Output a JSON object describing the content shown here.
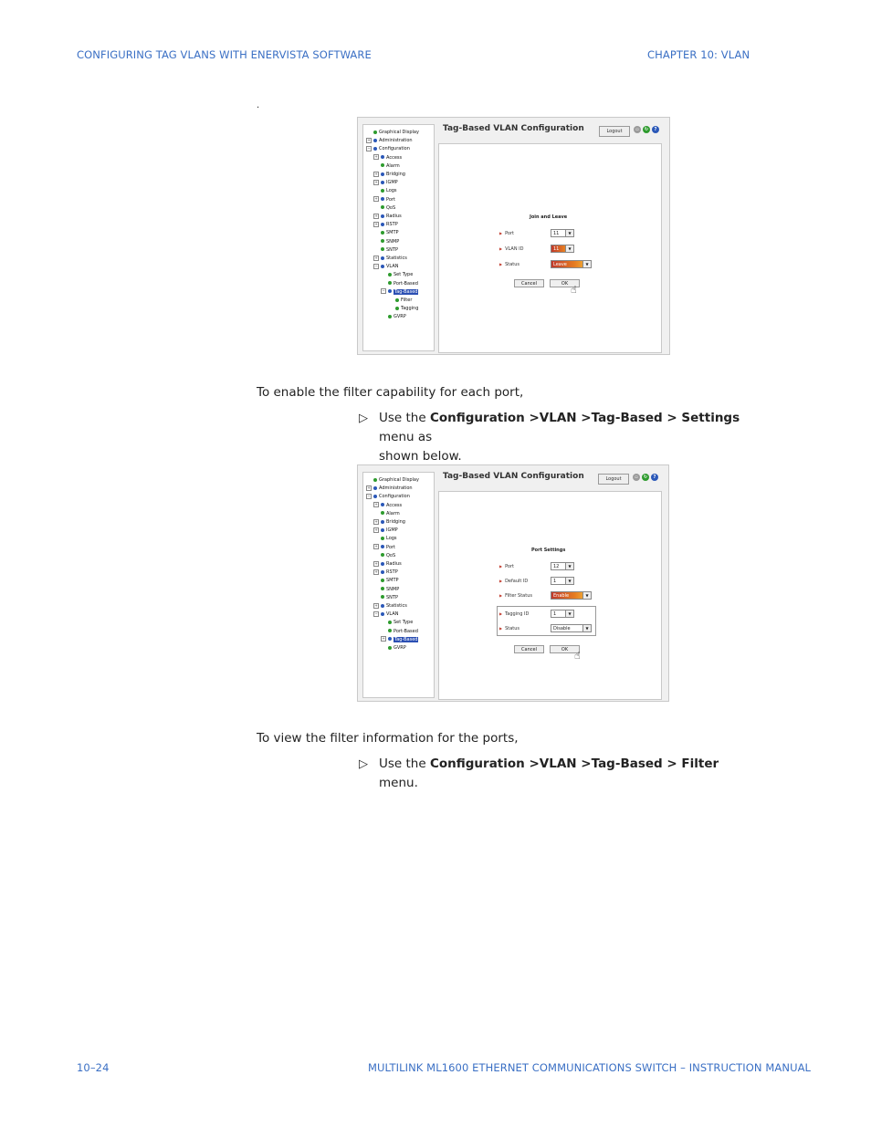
{
  "header": {
    "left": "CONFIGURING TAG VLANS WITH ENERVISTA SOFTWARE",
    "right": "CHAPTER 10: VLAN"
  },
  "stray_mark": ".",
  "shot1": {
    "title": "Tag-Based VLAN Configuration",
    "logout": "Logout",
    "tree": [
      {
        "label": "Graphical Display",
        "pm": "",
        "dot": "green"
      },
      {
        "label": "Administration",
        "pm": "+",
        "dot": "blue"
      },
      {
        "label": "Configuration",
        "pm": "−",
        "dot": "blue"
      },
      {
        "label": "Access",
        "pm": "+",
        "dot": "blue"
      },
      {
        "label": "Alarm",
        "pm": "",
        "dot": "green"
      },
      {
        "label": "Bridging",
        "pm": "+",
        "dot": "blue"
      },
      {
        "label": "IGMP",
        "pm": "+",
        "dot": "blue"
      },
      {
        "label": "Logs",
        "pm": "",
        "dot": "green"
      },
      {
        "label": "Port",
        "pm": "+",
        "dot": "blue"
      },
      {
        "label": "QoS",
        "pm": "",
        "dot": "green"
      },
      {
        "label": "Radius",
        "pm": "+",
        "dot": "blue"
      },
      {
        "label": "RSTP",
        "pm": "+",
        "dot": "blue"
      },
      {
        "label": "SMTP",
        "pm": "",
        "dot": "green"
      },
      {
        "label": "SNMP",
        "pm": "",
        "dot": "green"
      },
      {
        "label": "SNTP",
        "pm": "",
        "dot": "green"
      },
      {
        "label": "Statistics",
        "pm": "+",
        "dot": "blue"
      },
      {
        "label": "VLAN",
        "pm": "−",
        "dot": "blue"
      },
      {
        "label": "Set Type",
        "pm": "",
        "dot": "green"
      },
      {
        "label": "Port-Based",
        "pm": "",
        "dot": "green"
      },
      {
        "label": "Tag-Based",
        "pm": "−",
        "dot": "blue",
        "selected": true
      },
      {
        "label": "Filter",
        "pm": "",
        "dot": "green"
      },
      {
        "label": "Tagging",
        "pm": "",
        "dot": "green"
      },
      {
        "label": "GVRP",
        "pm": "",
        "dot": "green"
      }
    ],
    "form_title": "Join and Leave",
    "fields": [
      {
        "label": "Port",
        "value": "11",
        "hot": false
      },
      {
        "label": "VLAN ID",
        "value": "11",
        "hot": true
      },
      {
        "label": "Status",
        "value": "Leave",
        "hot": true
      }
    ],
    "cancel": "Cancel",
    "ok": "OK"
  },
  "instruction1": {
    "lead": "To enable the filter capability for each port,",
    "use": "Use the ",
    "bold": "Configuration >VLAN >Tag-Based > Settings",
    "rest": " menu as",
    "line2": "shown below."
  },
  "shot2": {
    "title": "Tag-Based VLAN Configuration",
    "logout": "Logout",
    "tree": [
      {
        "label": "Graphical Display",
        "pm": "",
        "dot": "green"
      },
      {
        "label": "Administration",
        "pm": "+",
        "dot": "blue"
      },
      {
        "label": "Configuration",
        "pm": "−",
        "dot": "blue"
      },
      {
        "label": "Access",
        "pm": "+",
        "dot": "blue"
      },
      {
        "label": "Alarm",
        "pm": "",
        "dot": "green"
      },
      {
        "label": "Bridging",
        "pm": "+",
        "dot": "blue"
      },
      {
        "label": "IGMP",
        "pm": "+",
        "dot": "blue"
      },
      {
        "label": "Logs",
        "pm": "",
        "dot": "green"
      },
      {
        "label": "Port",
        "pm": "+",
        "dot": "blue"
      },
      {
        "label": "QoS",
        "pm": "",
        "dot": "green"
      },
      {
        "label": "Radius",
        "pm": "+",
        "dot": "blue"
      },
      {
        "label": "RSTP",
        "pm": "+",
        "dot": "blue"
      },
      {
        "label": "SMTP",
        "pm": "",
        "dot": "green"
      },
      {
        "label": "SNMP",
        "pm": "",
        "dot": "green"
      },
      {
        "label": "SNTP",
        "pm": "",
        "dot": "green"
      },
      {
        "label": "Statistics",
        "pm": "+",
        "dot": "blue"
      },
      {
        "label": "VLAN",
        "pm": "−",
        "dot": "blue"
      },
      {
        "label": "Set Type",
        "pm": "",
        "dot": "green"
      },
      {
        "label": "Port-Based",
        "pm": "",
        "dot": "green"
      },
      {
        "label": "Tag-Based",
        "pm": "+",
        "dot": "blue",
        "selected": true
      },
      {
        "label": "GVRP",
        "pm": "",
        "dot": "green"
      }
    ],
    "form_title": "Port Settings",
    "fields": [
      {
        "label": "Port",
        "value": "12",
        "hot": false
      },
      {
        "label": "Default ID",
        "value": "1",
        "hot": false
      },
      {
        "label": "Filter Status",
        "value": "Enable",
        "hot": true
      }
    ],
    "sub_fields": [
      {
        "label": "Tagging ID",
        "value": "1"
      },
      {
        "label": "Status",
        "value": "Disable"
      }
    ],
    "cancel": "Cancel",
    "ok": "OK"
  },
  "instruction2": {
    "lead": "To view the filter information for the ports,",
    "use": "Use the ",
    "bold": "Configuration >VLAN >Tag-Based > Filter",
    "rest": " menu."
  },
  "footer": {
    "left": "10–24",
    "right": "MULTILINK ML1600 ETHERNET COMMUNICATIONS SWITCH – INSTRUCTION MANUAL"
  },
  "colors": {
    "header_blue": "#3a6fc4",
    "selection": "#2b4fb3"
  }
}
